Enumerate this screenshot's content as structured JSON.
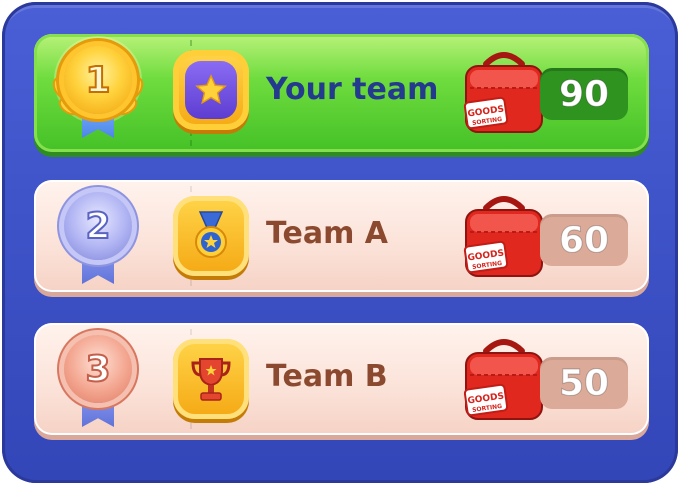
{
  "leaderboard": {
    "rows": [
      {
        "rank": "1",
        "team": "Your team",
        "score": "90",
        "medal": "gold-medal-icon",
        "badge": "star-shield-icon",
        "highlight": true
      },
      {
        "rank": "2",
        "team": "Team A",
        "score": "60",
        "medal": "silver-medal-icon",
        "badge": "medal-badge-icon",
        "highlight": false
      },
      {
        "rank": "3",
        "team": "Team B",
        "score": "50",
        "medal": "bronze-medal-icon",
        "badge": "trophy-badge-icon",
        "highlight": false
      }
    ],
    "bag_label": "GOODS SORTING",
    "colors": {
      "panel": "#3a4fc4",
      "highlight_row": "#5fd23a",
      "normal_row": "#fbe2d8",
      "team_name_highlight": "#243a8f",
      "team_name_normal": "#8b4a2f"
    }
  }
}
